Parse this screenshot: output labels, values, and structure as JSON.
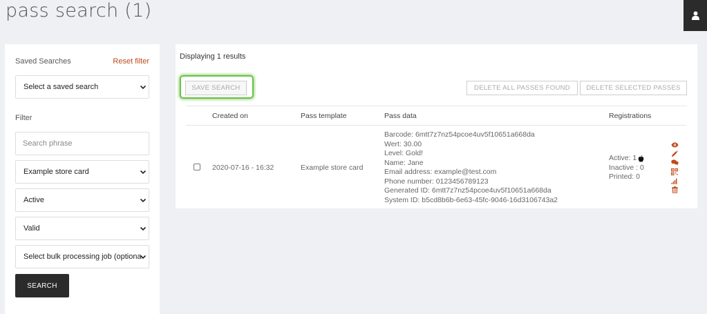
{
  "page": {
    "title": "pass search (1)"
  },
  "user_menu": {
    "icon": "user-icon"
  },
  "sidebar": {
    "saved_searches_label": "Saved Searches",
    "reset_filter_label": "Reset filter",
    "saved_search_select": "Select a saved search",
    "filter_label": "Filter",
    "search_placeholder": "Search phrase",
    "template_select": "Example store card",
    "status_select": "Active",
    "validity_select": "Valid",
    "bulk_job_select": "Select bulk processing job (optiona",
    "search_button": "SEARCH"
  },
  "main": {
    "results_text": "Displaying 1 results",
    "save_search_button": "SAVE SEARCH",
    "delete_all_button": "DELETE ALL PASSES FOUND",
    "delete_selected_button": "DELETE SELECTED PASSES",
    "columns": {
      "created_on": "Created on",
      "pass_template": "Pass template",
      "pass_data": "Pass data",
      "registrations": "Registrations"
    },
    "rows": [
      {
        "created_on": "2020-07-16 - 16:32",
        "pass_template": "Example store card",
        "pass_data": [
          "Barcode: 6mtt7z7nz54pcoe4uv5f10651a668da",
          "Wert: 30.00",
          "Level: Gold!",
          "Name: Jane",
          "Email address: example@test.com",
          "Phone number: 0123456789123",
          "Generated ID: 6mtt7z7nz54pcoe4uv5f10651a668da",
          "System ID: b5cd8b6b-6e63-45fc-9046-16d3106743a2"
        ],
        "registrations": {
          "active": "Active: 1",
          "inactive": "Inactive : 0",
          "printed": "Printed: 0"
        }
      }
    ]
  },
  "colors": {
    "accent": "#b94a18",
    "highlight": "#6abf4b",
    "dark": "#2b2b2b"
  },
  "icons": [
    "user-icon",
    "apple-icon",
    "eye-icon",
    "pencil-icon",
    "comments-icon",
    "qrcode-icon",
    "signal-icon",
    "trash-icon",
    "chevron-down-icon"
  ]
}
